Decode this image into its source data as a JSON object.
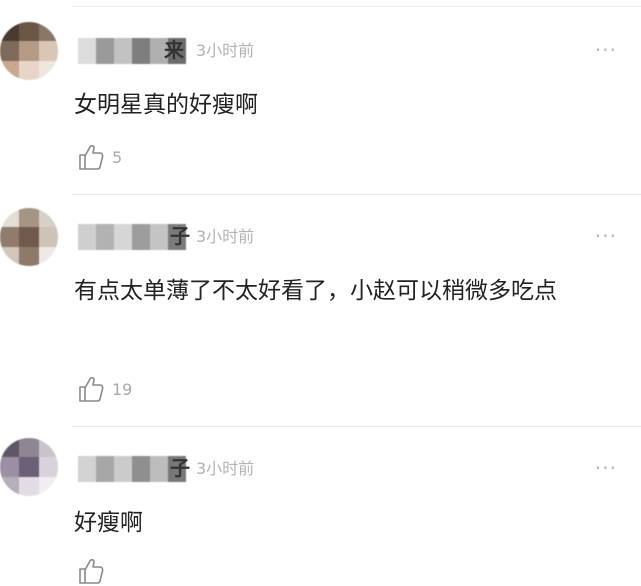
{
  "comments": [
    {
      "name_visible": "来",
      "time": "3小时前",
      "more": "···",
      "text": "女明星真的好瘦啊",
      "likes": "5",
      "avatar_colors": [
        "#4a3a30",
        "#6b5646",
        "#8a7766",
        "#7e6a58",
        "#b59a86",
        "#d9c6b6",
        "#c9a88f",
        "#e7d6c8",
        "#efe6de"
      ],
      "name_colors": [
        "#dcdcdc",
        "#9a9a9a",
        "#c2c2c2",
        "#7e7e7e",
        "#b0b0b0",
        "#6c6c6c"
      ]
    },
    {
      "name_visible": "子",
      "time": "3小时前",
      "more": "···",
      "text": "有点太单薄了不太好看了，小赵可以稍微多吃点",
      "likes": "19",
      "avatar_colors": [
        "#e4ddd6",
        "#a69484",
        "#d8cfc7",
        "#8f7c6c",
        "#6f5a4b",
        "#cfc3b8",
        "#d2c6bb",
        "#8c7a6b",
        "#efe9e4"
      ],
      "name_colors": [
        "#cfcfcf",
        "#b2b2b2",
        "#d6d6d6",
        "#9d9d9d",
        "#c4c4c4",
        "#7b7b7b"
      ]
    },
    {
      "name_visible": "子",
      "time": "3小时前",
      "more": "···",
      "text": "好瘦啊",
      "likes": "",
      "avatar_colors": [
        "#5e5666",
        "#8d8794",
        "#c9c4cc",
        "#9c8fa5",
        "#6b6075",
        "#d8d2dc",
        "#b5aebb",
        "#e2dde4",
        "#f1eef2"
      ],
      "name_colors": [
        "#d2d2d2",
        "#a7a7a7",
        "#cbcbcb",
        "#8f8f8f",
        "#bdbdbd",
        "#777777"
      ]
    }
  ]
}
